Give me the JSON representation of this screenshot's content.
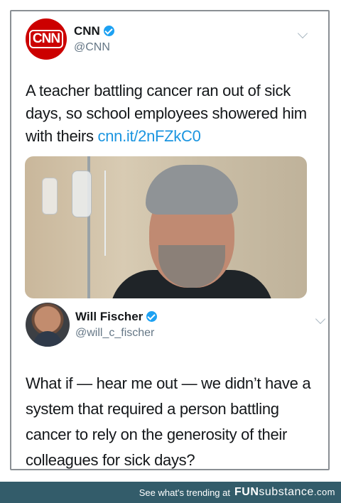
{
  "tweet": {
    "name": "CNN",
    "handle": "@CNN",
    "logo_text": "CNN",
    "text": "A teacher battling cancer ran out of sick days, so school employees showered him with theirs ",
    "link": "cnn.it/2nFZkC0"
  },
  "reply": {
    "name": "Will Fischer",
    "handle": "@will_c_fischer",
    "text": "What if — hear me out — we didn’t have a system that required a person battling cancer to rely on the generosity of their colleagues for sick days?"
  },
  "footer": {
    "text": "See what's trending at",
    "brand_bold": "FUN",
    "brand_rest": "substance",
    "brand_tld": ".com"
  },
  "colors": {
    "verified": "#1da1f2",
    "link": "#1b95e0",
    "footer_bg": "#335c6a",
    "cnn_red": "#cc0000"
  },
  "icons": [
    "verified-badge-icon",
    "chevron-down-icon"
  ]
}
